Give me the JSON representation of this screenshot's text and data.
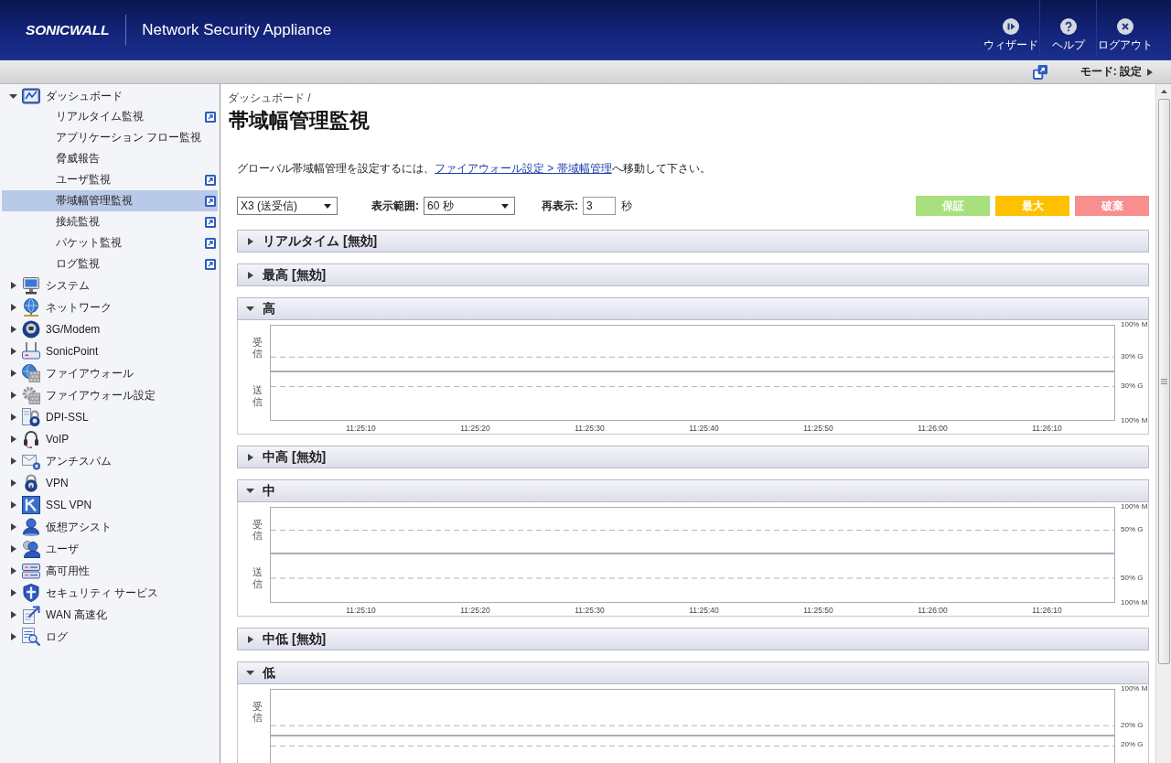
{
  "header": {
    "logo": "SONICWALL",
    "product": "Network Security Appliance",
    "actions": [
      {
        "label": "ウィザード"
      },
      {
        "label": "ヘルプ"
      },
      {
        "label": "ログアウト"
      }
    ]
  },
  "mode_bar": {
    "mode": "モード: 設定"
  },
  "sidebar": {
    "items": [
      {
        "label": "ダッシュボード",
        "expanded": true,
        "children": [
          {
            "label": "リアルタイム監視",
            "popout": true,
            "selected": false
          },
          {
            "label": "アプリケーション フロー監視",
            "popout": false,
            "selected": false
          },
          {
            "label": "脅威報告",
            "popout": false,
            "selected": false
          },
          {
            "label": "ユーザ監視",
            "popout": true,
            "selected": false
          },
          {
            "label": "帯域幅管理監視",
            "popout": true,
            "selected": true
          },
          {
            "label": "接続監視",
            "popout": true,
            "selected": false
          },
          {
            "label": "パケット監視",
            "popout": true,
            "selected": false
          },
          {
            "label": "ログ監視",
            "popout": true,
            "selected": false
          }
        ]
      },
      {
        "label": "システム",
        "expanded": false
      },
      {
        "label": "ネットワーク",
        "expanded": false
      },
      {
        "label": "3G/Modem",
        "expanded": false
      },
      {
        "label": "SonicPoint",
        "expanded": false
      },
      {
        "label": "ファイアウォール",
        "expanded": false
      },
      {
        "label": "ファイアウォール設定",
        "expanded": false
      },
      {
        "label": "DPI-SSL",
        "expanded": false
      },
      {
        "label": "VoIP",
        "expanded": false
      },
      {
        "label": "アンチスパム",
        "expanded": false
      },
      {
        "label": "VPN",
        "expanded": false
      },
      {
        "label": "SSL VPN",
        "expanded": false
      },
      {
        "label": "仮想アシスト",
        "expanded": false
      },
      {
        "label": "ユーザ",
        "expanded": false
      },
      {
        "label": "高可用性",
        "expanded": false
      },
      {
        "label": "セキュリティ サービス",
        "expanded": false
      },
      {
        "label": "WAN 高速化",
        "expanded": false
      },
      {
        "label": "ログ",
        "expanded": false
      }
    ]
  },
  "page": {
    "breadcrumb": "ダッシュボード /",
    "title": "帯域幅管理監視",
    "description": {
      "before": "グローバル帯域幅管理を設定するには、",
      "link": "ファイアウォール設定 > 帯域幅管理",
      "after": "へ移動して下さい。"
    }
  },
  "controls": {
    "interface": "X3 (送受信)",
    "range_label": "表示範囲:",
    "range": "60 秒",
    "refresh_label": "再表示:",
    "refresh": "3",
    "refresh_unit": "秒",
    "buttons": [
      {
        "label": "保証",
        "color": "#a8e07e"
      },
      {
        "label": "最大",
        "color": "#ffc000"
      },
      {
        "label": "破棄",
        "color": "#f88e8e"
      }
    ]
  },
  "sections": [
    {
      "title": "リアルタイム [無効]",
      "expanded": false
    },
    {
      "title": "最高 [無効]",
      "expanded": false
    },
    {
      "title": "高",
      "expanded": true,
      "panels": [
        {
          "chart_data": {
            "type": "line",
            "ylabel": "受信",
            "categories": [
              null,
              null,
              null,
              null,
              null,
              null,
              null
            ],
            "ylim": [
              0,
              100
            ],
            "yticks": [
              {
                "value": 100,
                "label": "100% M"
              },
              {
                "value": 30,
                "label": "30% G"
              }
            ]
          }
        },
        {
          "chart_data": {
            "type": "line",
            "ylabel": "送信",
            "categories": [
              "11:25:10",
              "11:25:20",
              "11:25:30",
              "11:25:40",
              "11:25:50",
              "11:26:00",
              "11:26:10"
            ],
            "ylim": [
              100,
              0
            ],
            "yticks": [
              {
                "value": 30,
                "label": "30% G"
              },
              {
                "value": 100,
                "label": "100% M"
              }
            ]
          }
        }
      ]
    },
    {
      "title": "中高 [無効]",
      "expanded": false
    },
    {
      "title": "中",
      "expanded": true,
      "panels": [
        {
          "chart_data": {
            "type": "line",
            "ylabel": "受信",
            "categories": [
              null,
              null,
              null,
              null,
              null,
              null,
              null
            ],
            "ylim": [
              0,
              100
            ],
            "yticks": [
              {
                "value": 100,
                "label": "100% M"
              },
              {
                "value": 50,
                "label": "50% G"
              }
            ]
          }
        },
        {
          "chart_data": {
            "type": "line",
            "ylabel": "送信",
            "categories": [
              "11:25:10",
              "11:25:20",
              "11:25:30",
              "11:25:40",
              "11:25:50",
              "11:26:00",
              "11:26:10"
            ],
            "ylim": [
              100,
              0
            ],
            "yticks": [
              {
                "value": 50,
                "label": "50% G"
              },
              {
                "value": 100,
                "label": "100% M"
              }
            ]
          }
        }
      ]
    },
    {
      "title": "中低 [無効]",
      "expanded": false
    },
    {
      "title": "低",
      "expanded": true,
      "panels": [
        {
          "chart_data": {
            "type": "line",
            "ylabel": "受信",
            "categories": [
              null,
              null,
              null,
              null,
              null,
              null,
              null
            ],
            "ylim": [
              0,
              100
            ],
            "yticks": [
              {
                "value": 100,
                "label": "100% M"
              },
              {
                "value": 20,
                "label": "20% G"
              }
            ]
          }
        },
        {
          "guide_label": "20% G"
        }
      ]
    }
  ]
}
